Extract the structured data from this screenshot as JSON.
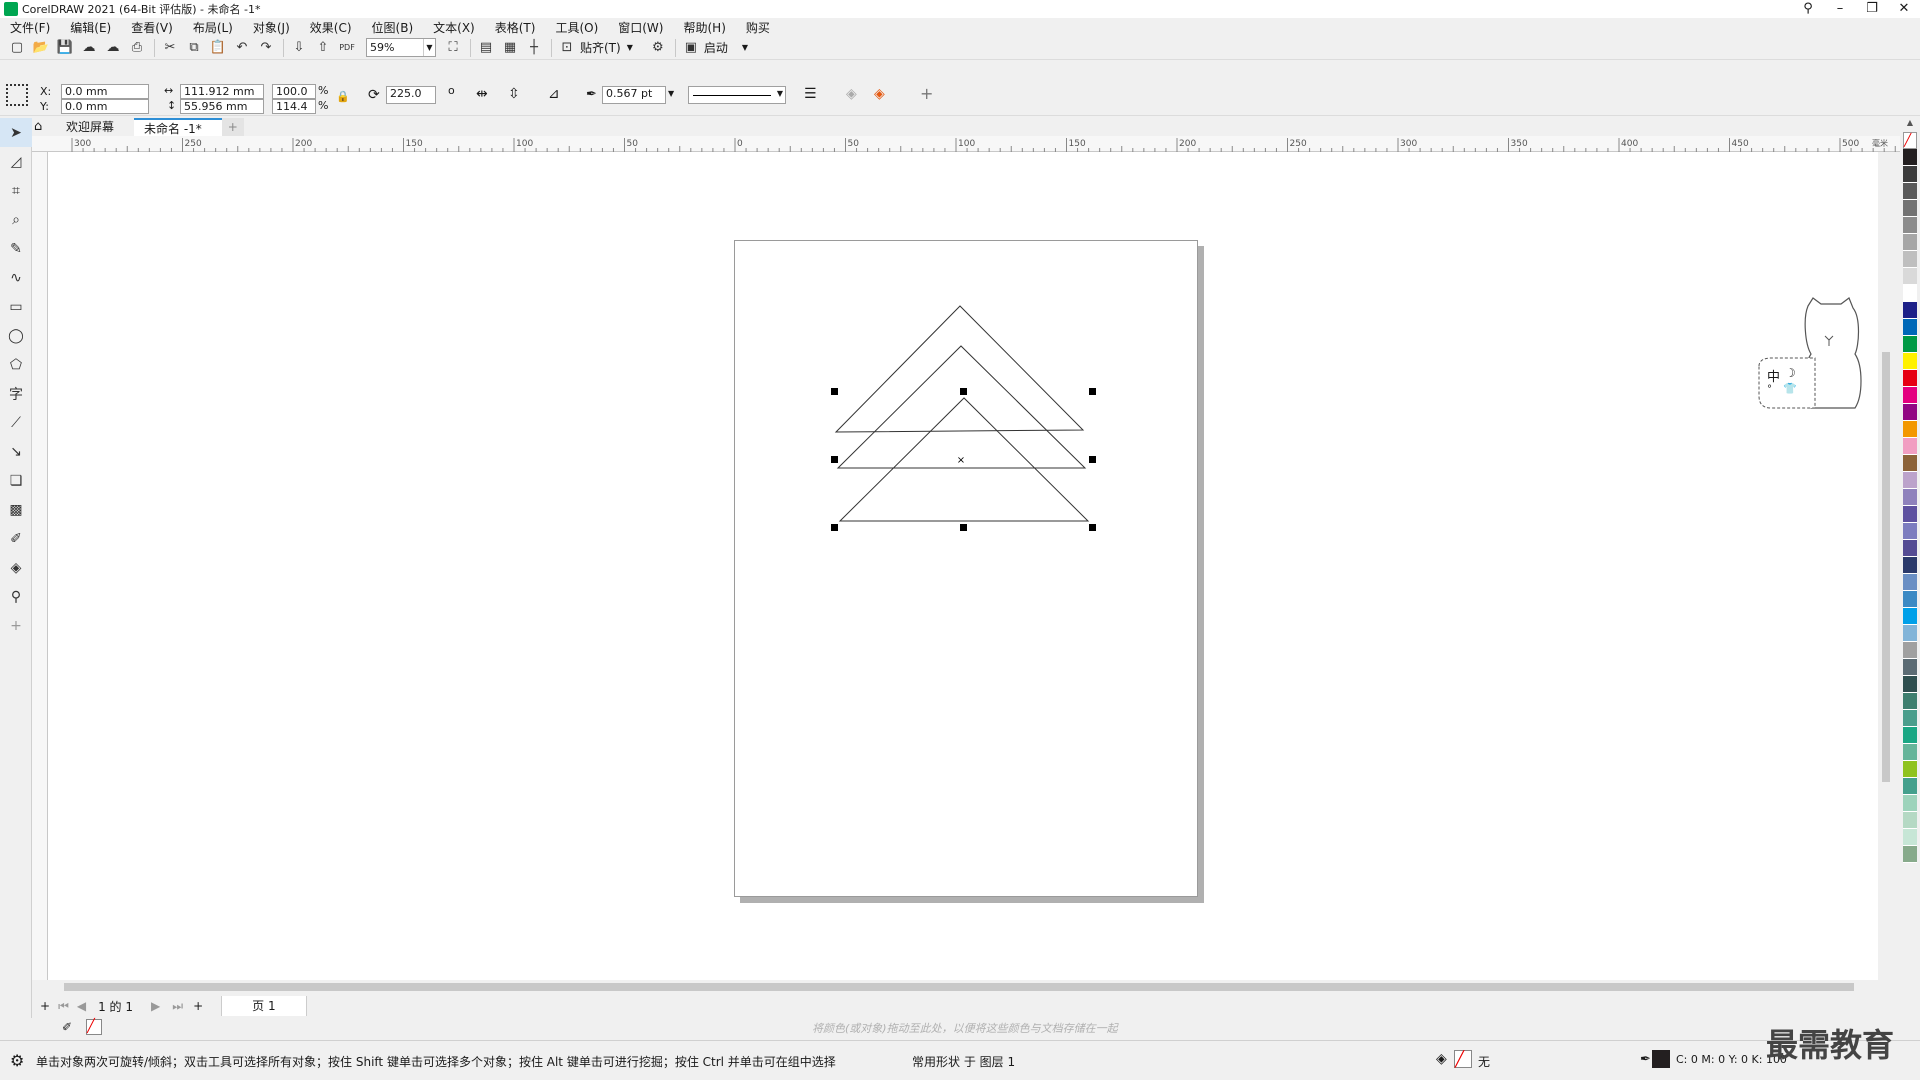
{
  "window": {
    "title": "CorelDRAW 2021 (64-Bit 评估版) - 未命名 -1*"
  },
  "menu": [
    "文件(F)",
    "编辑(E)",
    "查看(V)",
    "布局(L)",
    "对象(J)",
    "效果(C)",
    "位图(B)",
    "文本(X)",
    "表格(T)",
    "工具(O)",
    "窗口(W)",
    "帮助(H)",
    "购买"
  ],
  "toolbar": {
    "zoom": "59%",
    "snap_label": "贴齐(T)",
    "launch_label": "启动",
    "pdf_label": "PDF"
  },
  "props": {
    "x_label": "X:",
    "x": "0.0 mm",
    "y_label": "Y:",
    "y": "0.0 mm",
    "w": "111.912 mm",
    "h": "55.956 mm",
    "sx": "100.0",
    "sy": "114.4",
    "pct": "%",
    "angle": "225.0",
    "deg": "o",
    "outline": "0.567 pt"
  },
  "tabs": [
    {
      "label": "欢迎屏幕"
    },
    {
      "label": "未命名 -1*"
    }
  ],
  "ruler_labels": [
    "300",
    "250",
    "200",
    "150",
    "100",
    "50",
    "0",
    "50",
    "100",
    "150",
    "200",
    "250",
    "300",
    "350",
    "400",
    "450",
    "500"
  ],
  "ruler_unit": "毫米",
  "pagebar": {
    "page_of": "1 的 1",
    "page_tab": "页 1"
  },
  "colorbar_hint": "将颜色(或对象)拖动至此处，以便将这些颜色与文档存储在一起",
  "status": {
    "message": "单击对象两次可旋转/倾斜；双击工具可选择所有对象；按住 Shift 键单击可选择多个对象；按住 Alt 键单击可进行挖掘；按住 Ctrl 并单击可在组中选择",
    "layer": "常用形状 于 图层 1",
    "fill": "无",
    "cmyk": "C: 0 M: 0 Y: 0 K: 100"
  },
  "ime": {
    "label": "中"
  },
  "watermark": "最需教育",
  "palette": [
    "#231f20",
    "#3c3c3c",
    "#595959",
    "#737373",
    "#8c8c8c",
    "#a6a6a6",
    "#bfbfbf",
    "#d9d9d9",
    "#ffffff",
    "#1d2088",
    "#0068b7",
    "#009944",
    "#fff100",
    "#e60012",
    "#e4007f",
    "#920783",
    "#f39800",
    "#f19ec2",
    "#8c6239",
    "#bca3cb",
    "#8f82bc",
    "#5f52a0",
    "#7d7dbf",
    "#554c94",
    "#2b3a6b",
    "#6a8fc4",
    "#3c8ac4",
    "#00a0e9",
    "#82b4d8",
    "#a0a0a0",
    "#5b6b73",
    "#2f4f4f",
    "#3e7f6f",
    "#4b9e8c",
    "#1ba784",
    "#66b59a",
    "#8fc31f",
    "#44a08d",
    "#9dd3bb",
    "#b5d9c4",
    "#c7e6d6",
    "#87aa8b"
  ]
}
